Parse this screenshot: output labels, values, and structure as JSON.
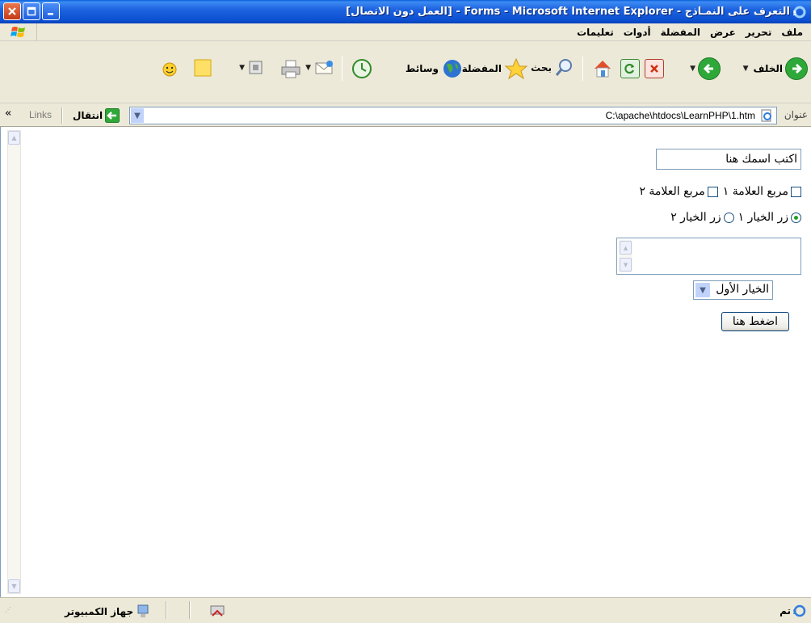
{
  "window": {
    "title": "التعرف على النمـاذج - Forms - Microsoft Internet Explorer - [العمل دون الاتصال]"
  },
  "menu": [
    "ملف",
    "تحرير",
    "عرض",
    "المفضلة",
    "أدوات",
    "تعليمات"
  ],
  "toolbar": {
    "back_label": "الخلف",
    "search_label": "بحث",
    "favorites_label": "المفضلة",
    "media_label": "وسائط"
  },
  "address": {
    "label": "عنوان",
    "value": "C:\\apache\\htdocs\\LearnPHP\\1.htm",
    "go_label": "انتقال",
    "links_label": "Links",
    "chevron": "«"
  },
  "form": {
    "text_value": "اكتب اسمك هنا",
    "checkbox1": "مربع العلامة ١",
    "checkbox2": "مربع العلامة ٢",
    "radio1": "زر الخيار ١",
    "radio2": "زر الخيار ٢",
    "select_value": "الخيار الأول",
    "submit_label": "اضغط هنا"
  },
  "status": {
    "done_label": "تم",
    "zone_label": "جهاز الكمبيوتر"
  },
  "colors": {
    "titlebar": "#0b4fd0",
    "chrome": "#ece9d8",
    "field_border": "#7f9db9",
    "radio_dot": "#21a121"
  }
}
